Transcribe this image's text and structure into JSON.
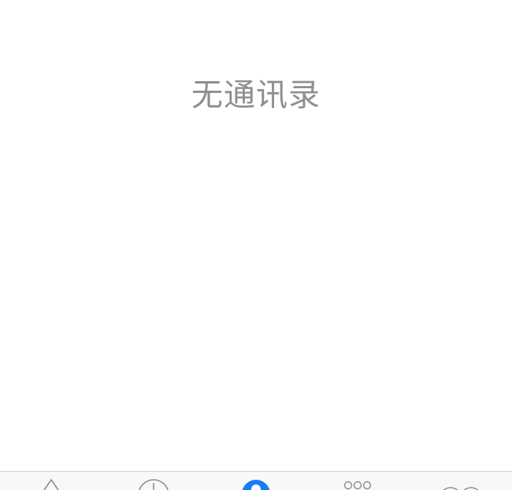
{
  "empty_state": {
    "message": "无通讯录"
  },
  "tab_bar": {
    "active_color": "#1a7cf5",
    "inactive_color": "#8e8e93",
    "tabs": [
      {
        "icon": "star-icon",
        "active": false
      },
      {
        "icon": "clock-icon",
        "active": false
      },
      {
        "icon": "person-icon",
        "active": true
      },
      {
        "icon": "keypad-icon",
        "active": false
      },
      {
        "icon": "voicemail-icon",
        "active": false
      }
    ]
  }
}
